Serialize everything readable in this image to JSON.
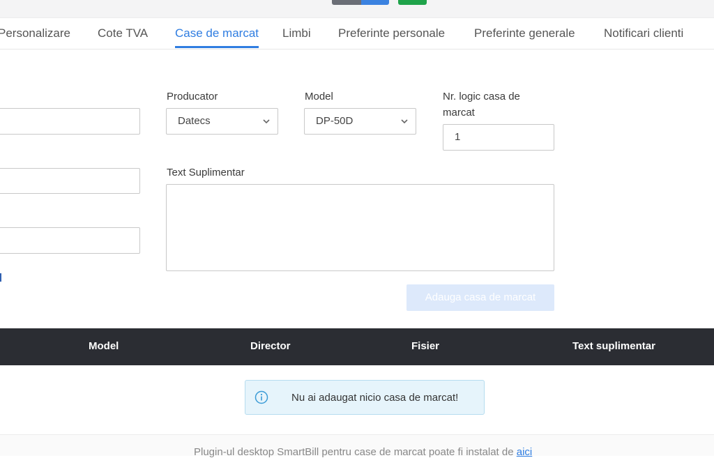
{
  "tabs": [
    {
      "label": "Personalizare"
    },
    {
      "label": "Cote TVA"
    },
    {
      "label": "Case de marcat",
      "active": true
    },
    {
      "label": "Limbi"
    },
    {
      "label": "Preferinte personale"
    },
    {
      "label": "Preferinte generale"
    },
    {
      "label": "Notificari clienti"
    }
  ],
  "form": {
    "producator": {
      "label": "Producator",
      "value": "Datecs"
    },
    "model": {
      "label": "Model",
      "value": "DP-50D"
    },
    "nr_logic": {
      "label_line1": "Nr. logic casa de",
      "label_line2": "marcat",
      "value": "1"
    },
    "text_suplimentar": {
      "label": "Text Suplimentar",
      "value": ""
    },
    "add_button": "Adauga casa de marcat"
  },
  "table": {
    "headers": [
      "Model",
      "Director",
      "Fisier",
      "Text suplimentar"
    ]
  },
  "empty_message": "Nu ai adaugat nicio casa de marcat!",
  "footer": {
    "text": "Plugin-ul desktop SmartBill pentru case de marcat poate fi instalat de ",
    "link": "aici"
  },
  "colors": {
    "accent": "#2f7de1",
    "table_header": "#2b2d33",
    "info_bg": "#e6f4fb",
    "button_disabled": "#dde9fb",
    "topbar_gray": "#6b6e76",
    "topbar_blue": "#3b82e0",
    "topbar_green": "#1fa34a"
  }
}
